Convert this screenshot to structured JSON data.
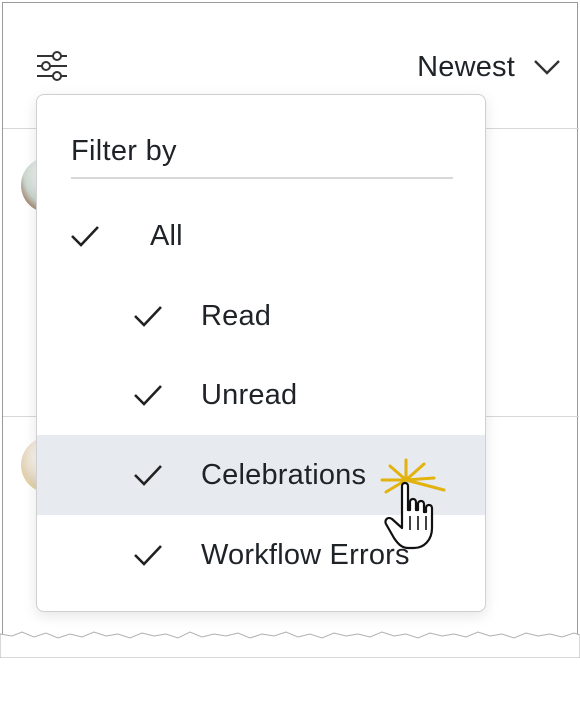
{
  "header": {
    "filter_icon": "sliders-icon",
    "sort": {
      "label": "Newest",
      "icon": "chevron-down-icon"
    }
  },
  "dropdown": {
    "title": "Filter by",
    "options": [
      {
        "label": "All",
        "checked": true,
        "level": 0
      },
      {
        "label": "Read",
        "checked": true,
        "level": 1
      },
      {
        "label": "Unread",
        "checked": true,
        "level": 1
      },
      {
        "label": "Celebrations",
        "checked": true,
        "level": 1,
        "hovered": true
      },
      {
        "label": "Workflow Errors",
        "checked": true,
        "level": 1
      }
    ]
  },
  "colors": {
    "text": "#1f2328",
    "hover_bg": "#e7eaee",
    "divider": "#d8d8d8",
    "cursor_spark": "#f2c41a"
  },
  "cursor_icon": "hand-pointer-icon"
}
